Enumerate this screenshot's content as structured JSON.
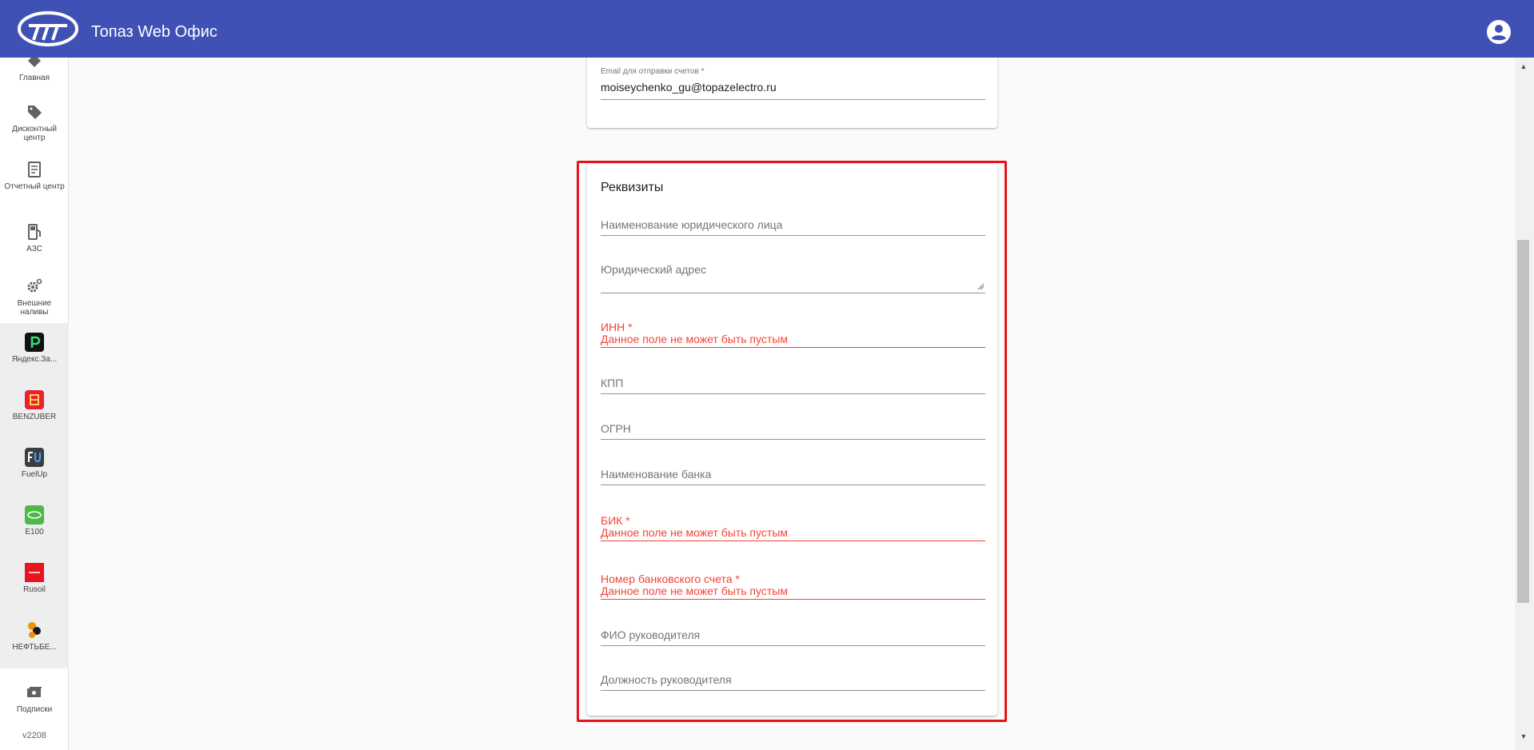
{
  "app": {
    "title": "Топаз Web Офис",
    "header_color": "#3f51b5"
  },
  "sidebar": {
    "items": [
      {
        "label": "Главная",
        "icon": "home-icon"
      },
      {
        "label": "Дисконтный центр",
        "icon": "tag-icon"
      },
      {
        "label": "Отчетный центр",
        "icon": "report-icon"
      },
      {
        "label": "АЗС",
        "icon": "fuel-station-icon"
      },
      {
        "label": "Внешние наливы",
        "icon": "gears-icon"
      },
      {
        "label": "Яндекс.За...",
        "icon": "yandex-zapravki-icon"
      },
      {
        "label": "BENZUBER",
        "icon": "benzuber-icon"
      },
      {
        "label": "FuelUp",
        "icon": "fuelup-icon"
      },
      {
        "label": "E100",
        "icon": "e100-icon"
      },
      {
        "label": "Rusoil",
        "icon": "rusoil-icon"
      },
      {
        "label": "НЕФТЬБЕ...",
        "icon": "neftbe-icon"
      },
      {
        "label": "Подписки",
        "icon": "subscriptions-icon"
      }
    ],
    "version": "v2208"
  },
  "top_card": {
    "email_label": "Email для отправки счетов *",
    "email_value": "moiseychenko_gu@topazelectro.ru"
  },
  "requisites": {
    "title": "Реквизиты",
    "fields": [
      {
        "label": "Наименование юридического лица",
        "error": false
      },
      {
        "label": "Юридический адрес",
        "error": false
      },
      {
        "label": "ИНН *",
        "error": true,
        "error_message": "Данное поле не может быть пустым"
      },
      {
        "label": "КПП",
        "error": false
      },
      {
        "label": "ОГРН",
        "error": false
      },
      {
        "label": "Наименование банка",
        "error": false
      },
      {
        "label": "БИК *",
        "error": true,
        "error_message": "Данное поле не может быть пустым"
      },
      {
        "label": "Номер банковского счета *",
        "error": true,
        "error_message": "Данное поле не может быть пустым"
      },
      {
        "label": "ФИО руководителя",
        "error": false
      },
      {
        "label": "Должность руководителя",
        "error": false
      }
    ]
  },
  "colors": {
    "error": "#f44336",
    "highlight_border": "#e5141b"
  }
}
